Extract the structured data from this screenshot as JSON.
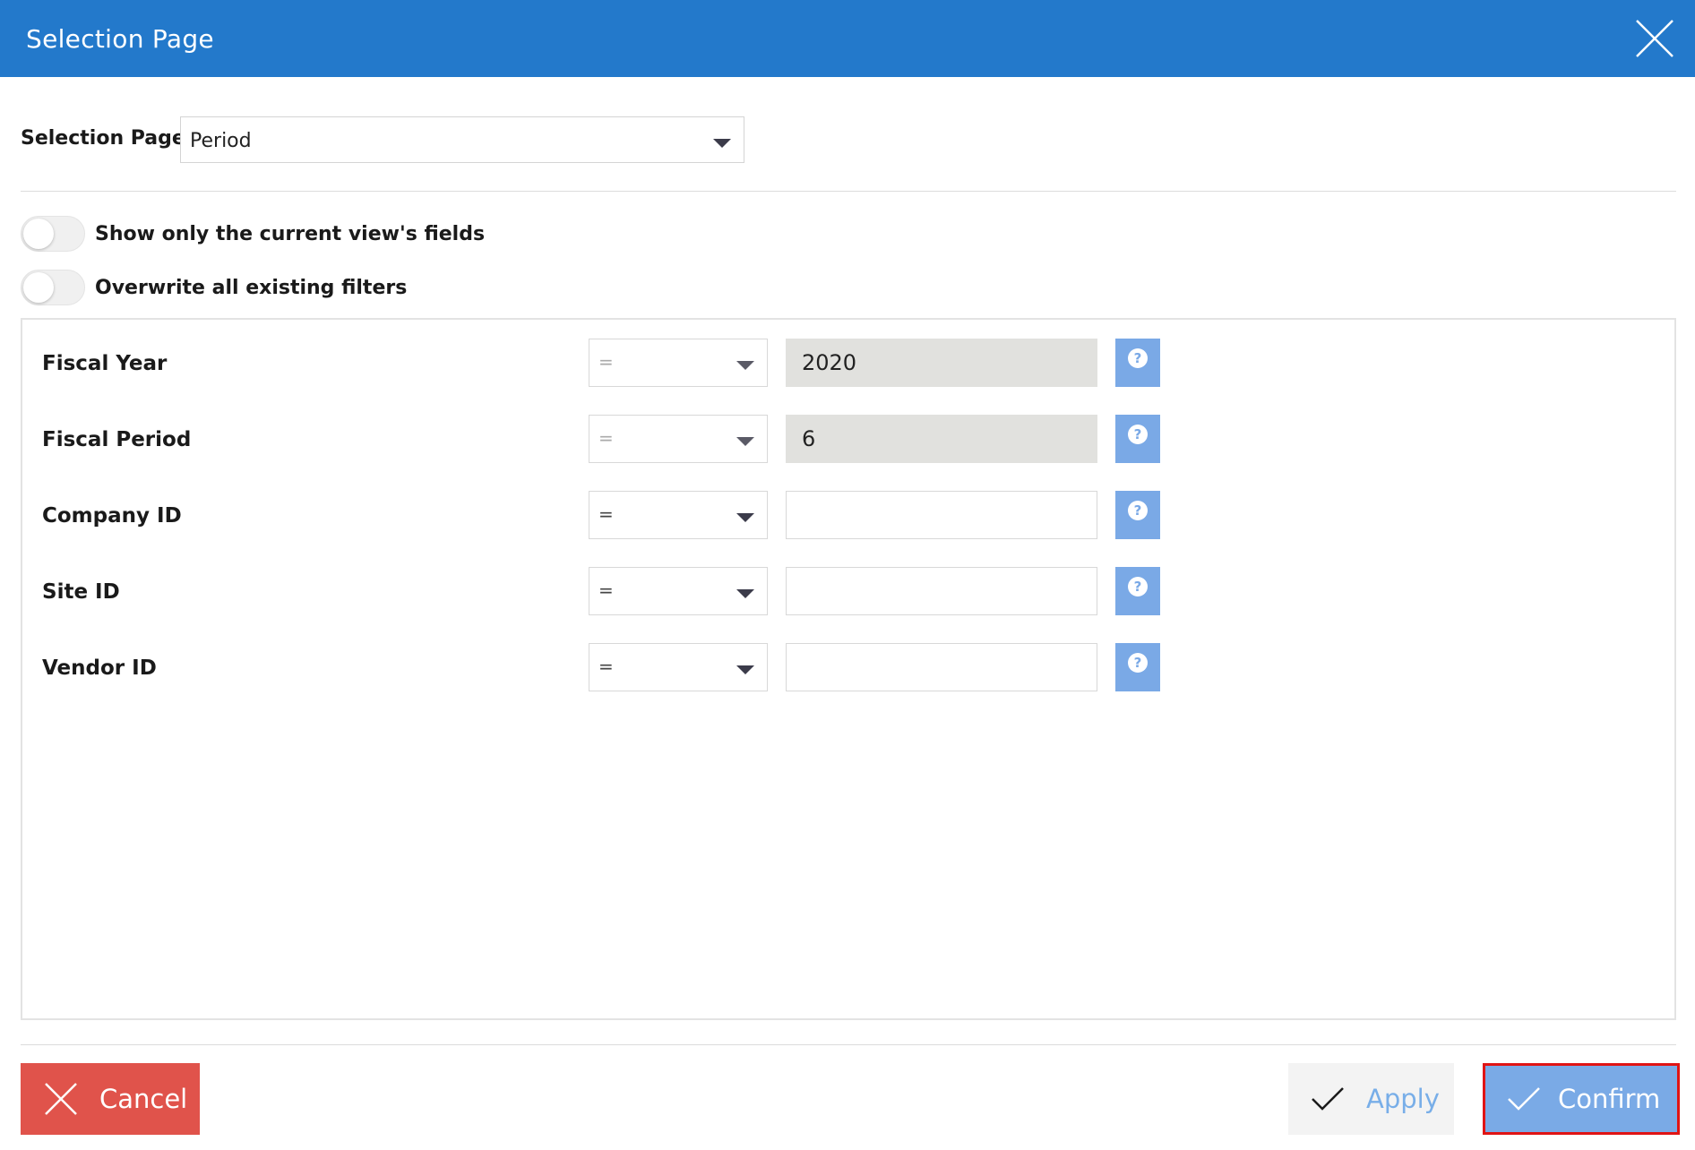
{
  "window": {
    "title": "Selection Page",
    "close_icon": "close-icon"
  },
  "selection": {
    "label": "Selection Page:",
    "value": "Period"
  },
  "toggles": [
    {
      "label": "Show only the current view's fields",
      "on": false
    },
    {
      "label": "Overwrite all existing filters",
      "on": false
    }
  ],
  "fields": [
    {
      "label": "Fiscal Year",
      "operator": "=",
      "value": "2020",
      "filled": true
    },
    {
      "label": "Fiscal Period",
      "operator": "=",
      "value": "6",
      "filled": true
    },
    {
      "label": "Company ID",
      "operator": "=",
      "value": "",
      "filled": false
    },
    {
      "label": "Site ID",
      "operator": "=",
      "value": "",
      "filled": false
    },
    {
      "label": "Vendor ID",
      "operator": "=",
      "value": "",
      "filled": false
    }
  ],
  "footer": {
    "cancel_label": "Cancel",
    "apply_label": "Apply",
    "confirm_label": "Confirm"
  },
  "colors": {
    "header": "#2379cb",
    "cancel": "#e0534b",
    "confirm": "#7aaae6",
    "help": "#7aa9e6",
    "highlight": "#e01414"
  }
}
